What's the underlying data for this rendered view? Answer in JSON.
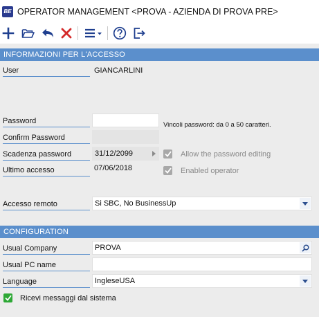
{
  "window": {
    "title": "OPERATOR MANAGEMENT <PROVA - AZIENDA DI PROVA PRE>",
    "app_icon_text": "BE"
  },
  "toolbar": {
    "buttons": [
      {
        "icon": "plus-icon",
        "color": "#1f3f8f"
      },
      {
        "icon": "folder-open-icon",
        "color": "#1f3f8f"
      },
      {
        "icon": "undo-icon",
        "color": "#1f3f8f"
      },
      {
        "icon": "delete-x-icon",
        "color": "#d42a2a"
      },
      {
        "icon": "menu-icon",
        "color": "#1f3f8f"
      },
      {
        "icon": "help-icon",
        "color": "#1f3f8f"
      },
      {
        "icon": "exit-icon",
        "color": "#1f3f8f"
      }
    ]
  },
  "access": {
    "header": "INFORMAZIONI PER L'ACCESSO",
    "user_label": "User",
    "user_value": "GIANCARLINI",
    "password_label": "Password",
    "password_value": "",
    "password_hint": "Vincoli password: da 0 a 50 caratteri.",
    "confirm_label": "Confirm Password",
    "confirm_value": "",
    "expiry_label": "Scadenza password",
    "expiry_value": "31/12/2099",
    "last_access_label": "Ultimo accesso",
    "last_access_value": "07/06/2018",
    "allow_edit_label": "Allow the password editing",
    "allow_edit_checked": true,
    "enabled_label": "Enabled operator",
    "enabled_checked": true,
    "remote_label": "Accesso remoto",
    "remote_value": "Si SBC, No BusinessUp"
  },
  "configuration": {
    "header": "CONFIGURATION",
    "company_label": "Usual Company",
    "company_value": "PROVA",
    "pc_label": "Usual PC name",
    "pc_value": "",
    "language_label": "Language",
    "language_value": "IngleseUSA",
    "messages_label": "Ricevi messaggi dal sistema",
    "messages_checked": true
  },
  "colors": {
    "accent": "#5b8fcc",
    "toolbar_icon": "#1f3f8f",
    "delete": "#d42a2a",
    "check_on": "#2ea836",
    "check_disabled": "#a8a8a8"
  }
}
